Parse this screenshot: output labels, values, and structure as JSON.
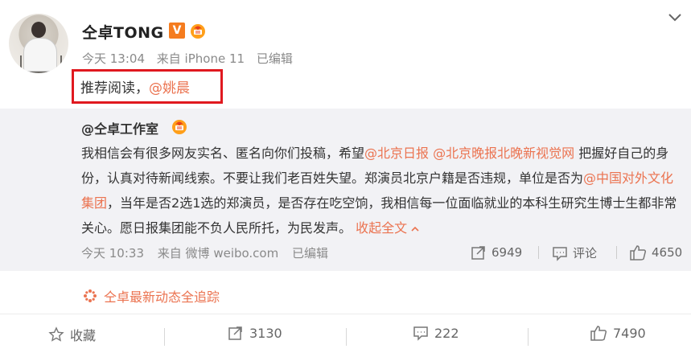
{
  "post": {
    "author": "仝卓TONG",
    "verified_badge": "V",
    "time": "今天 13:04",
    "source": "来自 iPhone 11",
    "edited": "已编辑",
    "text_prefix": "推荐阅读，",
    "mention": "@姚晨"
  },
  "repost": {
    "author": "@仝卓工作室",
    "body_1": "我相信会有很多网友实名、匿名向你们投稿，希望",
    "link_1": "@北京日报",
    "link_2": "@北京晚报北晚新视觉网",
    "body_2": " 把握好自己的身份，认真对待新闻线索。不要让我们老百姓失望。郑演员北京户籍是否违规，单位是否为",
    "link_3": "@中国对外文化集团",
    "body_3": "，当年是否2选1选的郑演员，是否存在吃空饷，我相信每一位面临就业的本科生研究生博士生都非常关心。愿日报集团能不负人民所托，为民发声。",
    "collapse": "收起全文",
    "time": "今天 10:33",
    "source": "来自 微博 weibo.com",
    "edited": "已编辑",
    "shares": "6949",
    "comment_label": "评论",
    "likes": "4650"
  },
  "tracking": "仝卓最新动态全追踪",
  "actions": {
    "favorite": "收藏",
    "shares": "3130",
    "comments": "222",
    "likes": "7490"
  },
  "colors": {
    "accent": "#eb7350",
    "highlight_box": "#e0191f",
    "verified": "#f57c1f"
  }
}
